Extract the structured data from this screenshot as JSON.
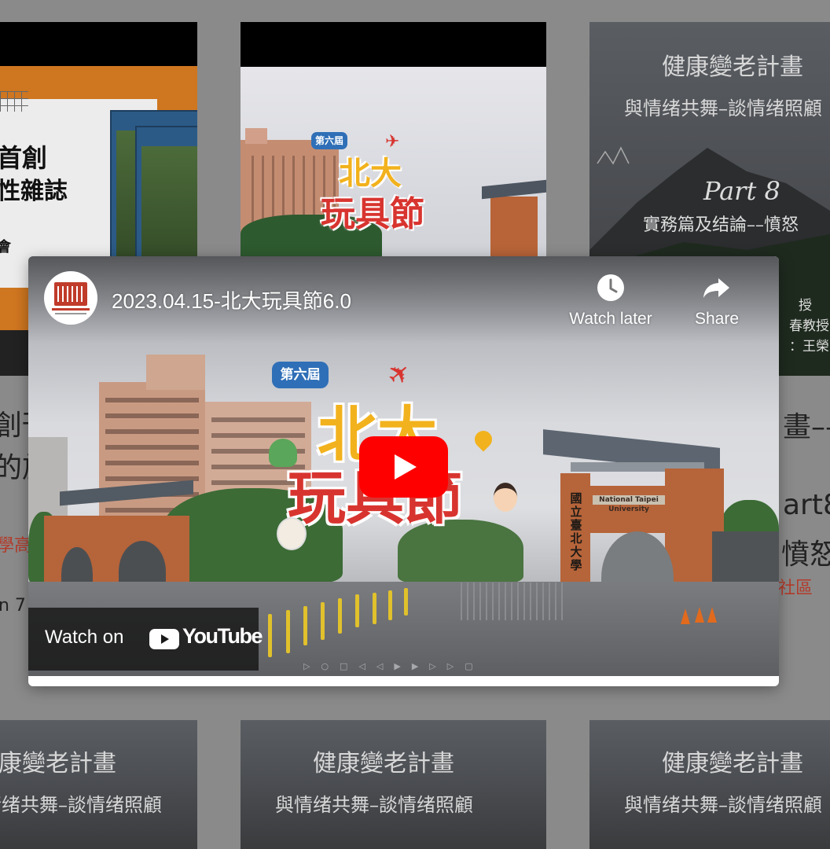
{
  "cards_top": [
    {
      "id": "magazine",
      "title_line1": "首創",
      "title_line2": "性雜誌",
      "footer": "會"
    },
    {
      "id": "toy-festival",
      "badge": "第六屆",
      "logo_line1": "北大",
      "logo_line2": "玩具節"
    },
    {
      "id": "emotion-poster",
      "line1": "健康變老計畫",
      "line2": "與情绪共舞–談情绪照顧",
      "part": "Part 8",
      "subtitle": "實務篇及结論––憤怒",
      "credit1": "授",
      "credit2": "春教授",
      "credit3": "：王榮"
    }
  ],
  "behind_text": {
    "left_line1": "創刊",
    "left_line2": "的旅",
    "left_link": "學高",
    "left_meta": "n 7",
    "right_line1": "畫––",
    "right_line2": "art8",
    "right_line3": "憤怒",
    "right_link": "社區"
  },
  "cards_bottom": [
    {
      "line1": "健康變老計畫",
      "line2": "與情绪共舞–談情绪照顧"
    },
    {
      "line1": "健康變老計畫",
      "line2": "與情绪共舞–談情绪照顧"
    },
    {
      "line1": "健康變老計畫",
      "line2": "與情绪共舞–談情绪照顧"
    }
  ],
  "video": {
    "title": "2023.04.15-北大玩具節6.0",
    "watch_later_label": "Watch later",
    "share_label": "Share",
    "watch_on_label": "Watch on",
    "youtube_label": "YouTube",
    "badge": "第六屆",
    "logo_line1": "北大",
    "logo_line2": "玩具節",
    "gate_sign": "National Taipei University",
    "gate_vertical": "國立臺北大學"
  },
  "colors": {
    "youtube_red": "#ff0000",
    "logo_yellow": "#f2b21d",
    "logo_red": "#d8342f",
    "link_red": "#c0392b"
  }
}
